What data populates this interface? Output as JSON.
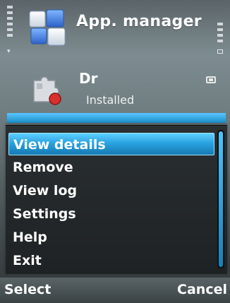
{
  "header": {
    "title": "App. manager",
    "icon": "app-manager-icon"
  },
  "list": {
    "items": [
      {
        "name": "Dr",
        "status": "Installed",
        "icon": "puzzle-package-icon"
      }
    ]
  },
  "menu": {
    "items": [
      {
        "label": "View details",
        "selected": true
      },
      {
        "label": "Remove"
      },
      {
        "label": "View log"
      },
      {
        "label": "Settings"
      },
      {
        "label": "Help"
      },
      {
        "label": "Exit"
      }
    ]
  },
  "softkeys": {
    "left": "Select",
    "right": "Cancel"
  },
  "colors": {
    "highlight": "#2aa2e0",
    "menu_bg": "#1e2224",
    "text": "#ffffff"
  }
}
